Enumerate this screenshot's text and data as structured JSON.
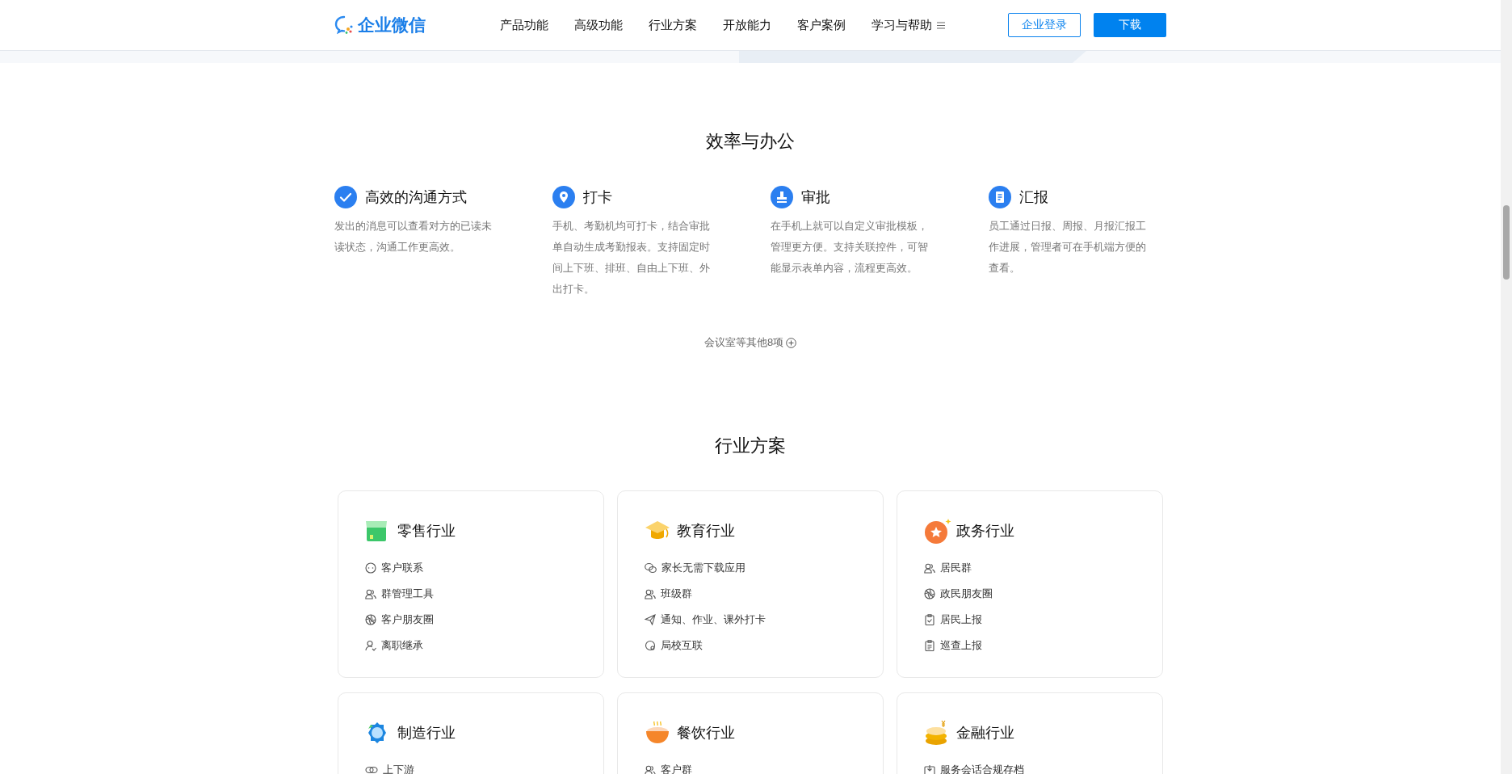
{
  "header": {
    "logo_text": "企业微信",
    "nav": [
      {
        "label": "产品功能"
      },
      {
        "label": "高级功能"
      },
      {
        "label": "行业方案"
      },
      {
        "label": "开放能力"
      },
      {
        "label": "客户案例"
      },
      {
        "label": "学习与帮助",
        "has_menu": true
      }
    ],
    "login_button": "企业登录",
    "download_button": "下载"
  },
  "efficiency": {
    "title": "效率与办公",
    "features": [
      {
        "title": "高效的沟通方式",
        "description": "发出的消息可以查看对方的已读未读状态，沟通工作更高效。"
      },
      {
        "title": "打卡",
        "description": "手机、考勤机均可打卡，结合审批单自动生成考勤报表。支持固定时间上下班、排班、自由上下班、外出打卡。"
      },
      {
        "title": "审批",
        "description": "在手机上就可以自定义审批模板，管理更方便。支持关联控件，可智能显示表单内容，流程更高效。"
      },
      {
        "title": "汇报",
        "description": "员工通过日报、周报、月报汇报工作进展，管理者可在手机端方便的查看。"
      }
    ],
    "more_link": "会议室等其他8项"
  },
  "industries": {
    "title": "行业方案",
    "cards": [
      {
        "title": "零售行业",
        "items": [
          "客户联系",
          "群管理工具",
          "客户朋友圈",
          "离职继承"
        ]
      },
      {
        "title": "教育行业",
        "items": [
          "家长无需下载应用",
          "班级群",
          "通知、作业、课外打卡",
          "局校互联"
        ]
      },
      {
        "title": "政务行业",
        "items": [
          "居民群",
          "政民朋友圈",
          "居民上报",
          "巡查上报"
        ]
      },
      {
        "title": "制造行业",
        "items": [
          "上下游"
        ]
      },
      {
        "title": "餐饮行业",
        "items": [
          "客户群"
        ]
      },
      {
        "title": "金融行业",
        "items": [
          "服务会话合规存档"
        ]
      }
    ]
  }
}
